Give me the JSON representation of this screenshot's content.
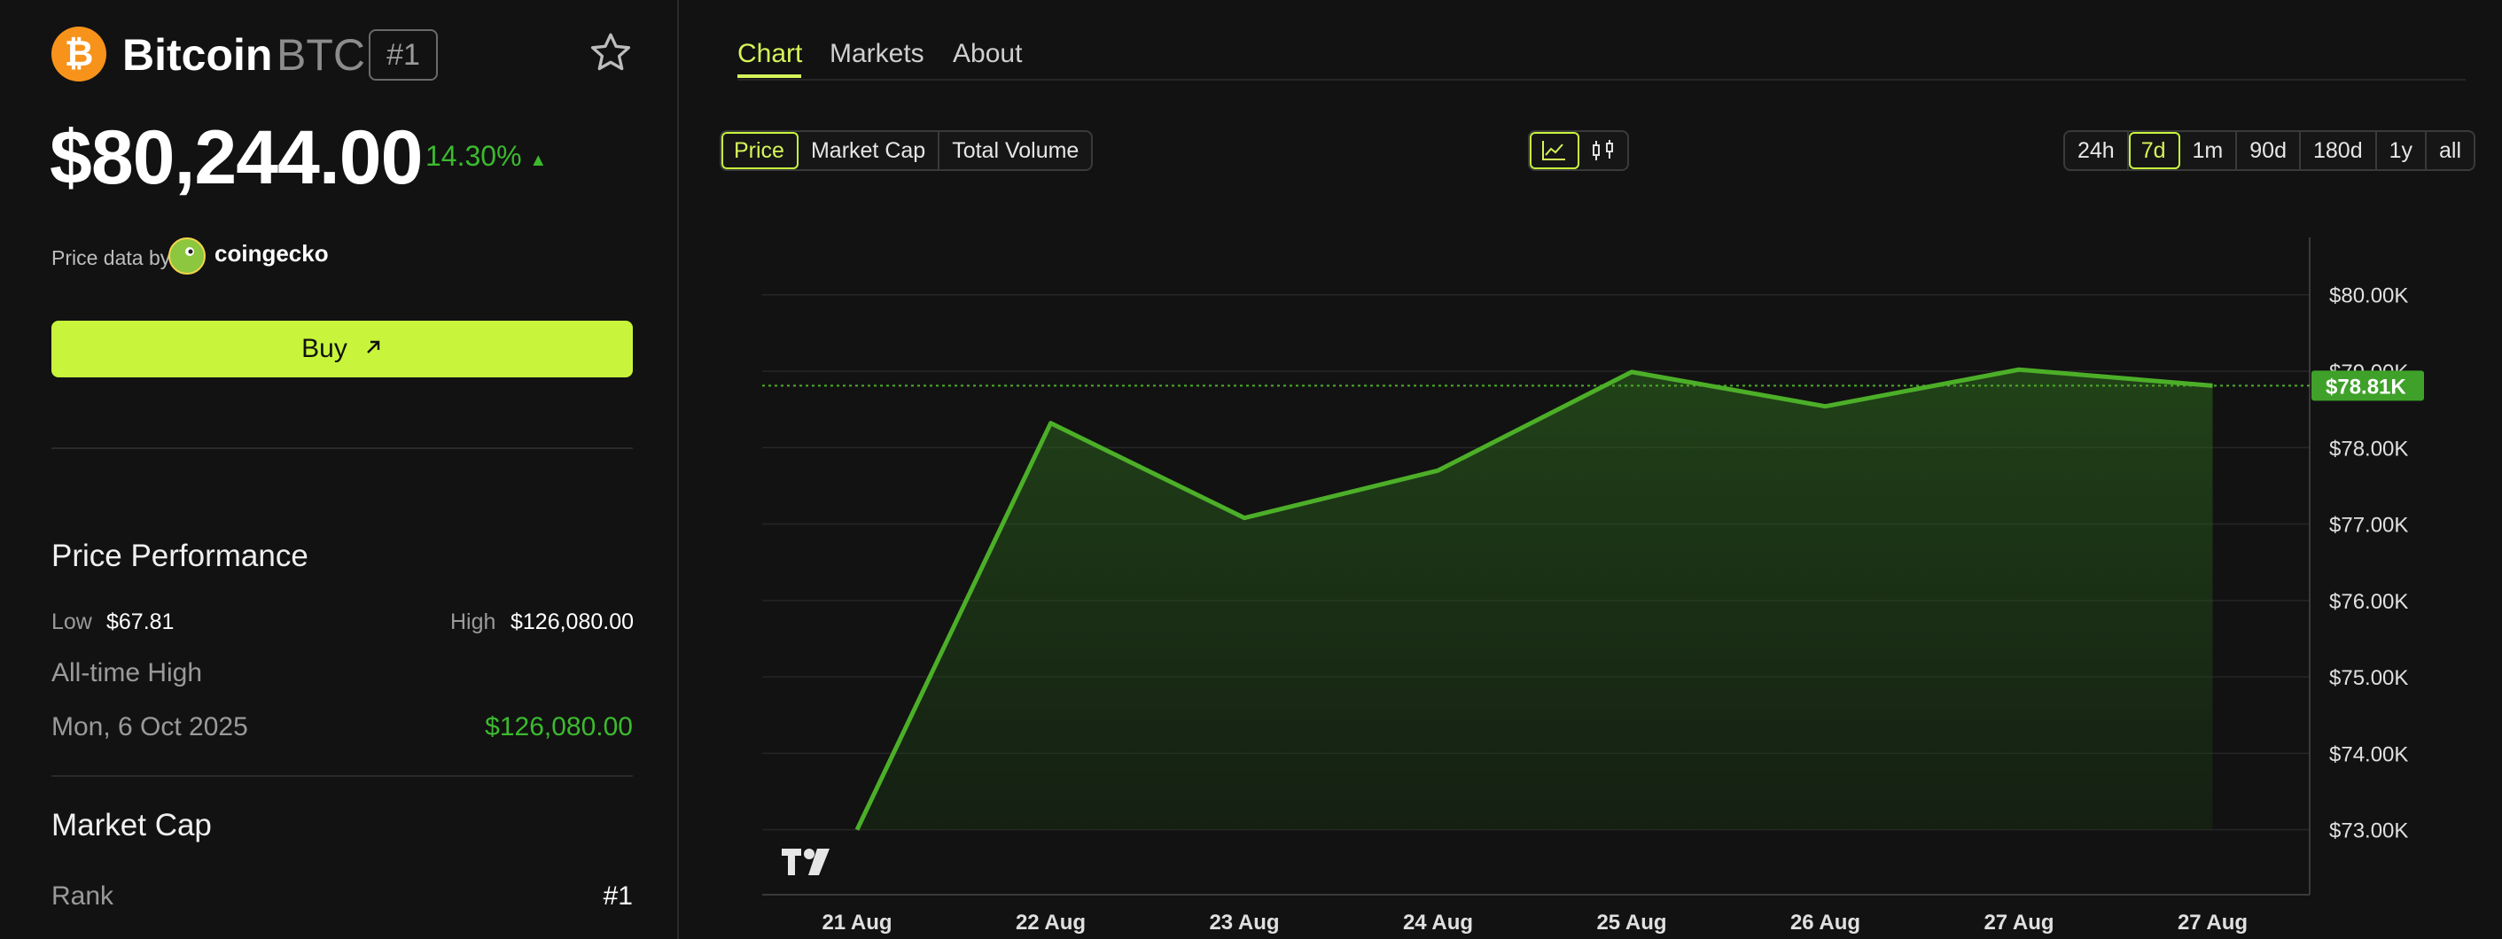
{
  "coin": {
    "name": "Bitcoin",
    "symbol": "BTC",
    "rank_badge": "#1",
    "icon_glyph": "₿",
    "price": "$80,244.00",
    "change_pct": "14.30%",
    "change_dir_icon": "triangle-up-icon"
  },
  "source": {
    "label": "Price data by",
    "name": "coingecko"
  },
  "buy_button": {
    "label": "Buy",
    "icon": "arrow-up-right-icon"
  },
  "price_performance": {
    "title": "Price Performance",
    "low_label": "Low",
    "low_value": "$67.81",
    "high_label": "High",
    "high_value": "$126,080.00",
    "ath_label": "All-time High",
    "ath_date": "Mon, 6 Oct 2025",
    "ath_value": "$126,080.00"
  },
  "market_cap": {
    "title": "Market Cap",
    "rank_label": "Rank",
    "rank_value": "#1"
  },
  "tabs": [
    {
      "label": "Chart",
      "active": true
    },
    {
      "label": "Markets",
      "active": false
    },
    {
      "label": "About",
      "active": false
    }
  ],
  "metric_buttons": [
    {
      "label": "Price",
      "active": true
    },
    {
      "label": "Market Cap",
      "active": false
    },
    {
      "label": "Total Volume",
      "active": false
    }
  ],
  "chart_type_buttons": [
    {
      "icon": "line-chart-icon",
      "active": true
    },
    {
      "icon": "candlestick-icon",
      "active": false
    }
  ],
  "range_buttons": [
    {
      "label": "24h",
      "active": false
    },
    {
      "label": "7d",
      "active": true
    },
    {
      "label": "1m",
      "active": false
    },
    {
      "label": "90d",
      "active": false
    },
    {
      "label": "180d",
      "active": false
    },
    {
      "label": "1y",
      "active": false
    },
    {
      "label": "all",
      "active": false
    }
  ],
  "colors": {
    "accent": "#c8f53b",
    "positive": "#3cba2e",
    "line": "#4caf28",
    "background": "#121212"
  },
  "chart_data": {
    "type": "area",
    "x": [
      "21 Aug",
      "22 Aug",
      "23 Aug",
      "24 Aug",
      "25 Aug",
      "26 Aug",
      "27 Aug",
      "27 Aug"
    ],
    "values": [
      73000,
      78320,
      77080,
      77700,
      78990,
      78540,
      79020,
      78810
    ],
    "ylim": [
      72150,
      80750
    ],
    "y_ticks": [
      73000,
      74000,
      75000,
      76000,
      77000,
      78000,
      79000,
      80000
    ],
    "y_tick_labels": [
      "$73.00K",
      "$74.00K",
      "$75.00K",
      "$76.00K",
      "$77.00K",
      "$78.00K",
      "$79.00K",
      "$80.00K"
    ],
    "current_value": 78810,
    "current_label": "$78.81K",
    "grid": true,
    "y_axis_position": "right",
    "watermark": "TV"
  }
}
